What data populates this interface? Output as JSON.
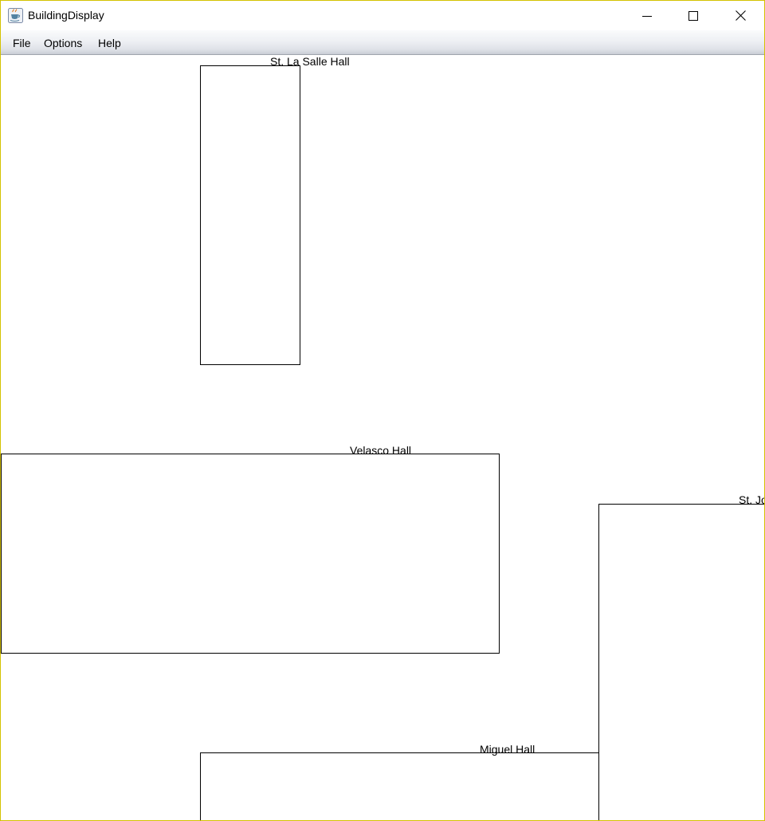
{
  "window": {
    "title": "BuildingDisplay",
    "icon": "java-cup-icon",
    "controls": {
      "minimize": "minimize-icon",
      "maximize": "maximize-icon",
      "close": "close-icon"
    }
  },
  "menu": {
    "file": "File",
    "options": "Options",
    "help": "Help"
  },
  "buildings": [
    {
      "name": "St. La Salle Hall"
    },
    {
      "name": "Velasco Hall"
    },
    {
      "name": "St. Jo"
    },
    {
      "name": "Miguel Hall"
    }
  ]
}
